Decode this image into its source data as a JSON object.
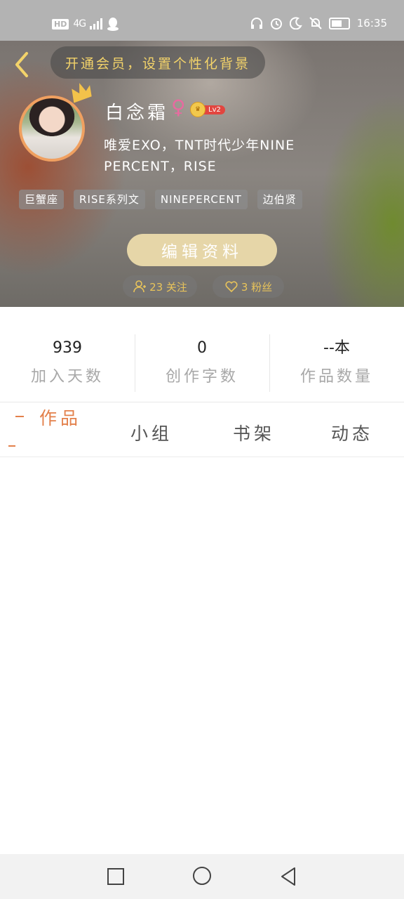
{
  "status_bar": {
    "network_label": "HD",
    "network_type": "4G",
    "time": "16:35",
    "icons": [
      "signal-icon",
      "qq-icon",
      "headphones-icon",
      "alarm-icon",
      "moon-icon",
      "mute-icon",
      "battery-icon"
    ]
  },
  "header": {
    "vip_banner": "开通会员，设置个性化背景",
    "username": "白念霜",
    "gender_symbol": "♀",
    "level": "Lv2",
    "bio": "唯爱EXO，TNT时代少年NINE PERCENT，RISE",
    "tags": [
      "巨蟹座",
      "RISE系列文",
      "NINEPERCENT",
      "边伯贤"
    ],
    "edit_button": "编辑资料",
    "follow_label": "23 关注",
    "fans_label": "3 粉丝",
    "accent_color": "#f3d36a"
  },
  "stats": [
    {
      "value": "939",
      "label": "加入天数"
    },
    {
      "value": "0",
      "label": "创作字数"
    },
    {
      "value": "--本",
      "label": "作品数量"
    }
  ],
  "tabs": [
    {
      "label": "作品",
      "active": true
    },
    {
      "label": "小组",
      "active": false
    },
    {
      "label": "书架",
      "active": false
    },
    {
      "label": "动态",
      "active": false
    }
  ],
  "active_tab_color": "#e3804b"
}
